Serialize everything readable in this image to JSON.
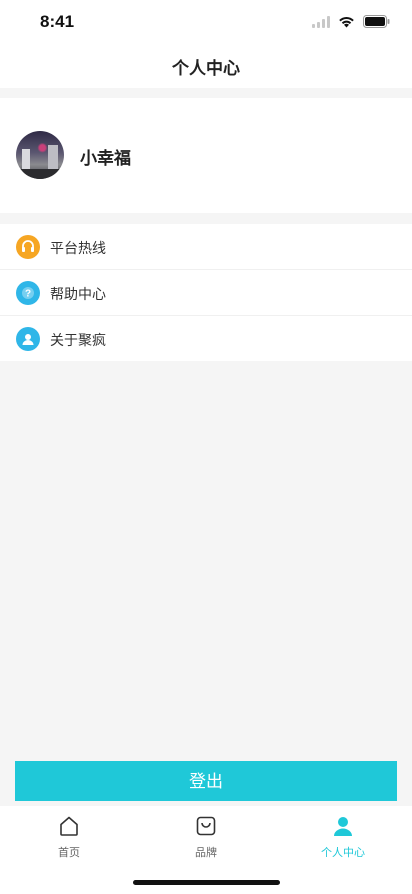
{
  "status_bar": {
    "time": "8:41"
  },
  "nav": {
    "title": "个人中心"
  },
  "profile": {
    "username": "小幸福"
  },
  "menu": {
    "items": [
      {
        "label": "平台热线",
        "icon": "headset-icon",
        "color": "#f6a623"
      },
      {
        "label": "帮助中心",
        "icon": "question-icon",
        "color": "#2fb6e8"
      },
      {
        "label": "关于聚疯",
        "icon": "user-icon",
        "color": "#2fb6e8"
      }
    ]
  },
  "logout": {
    "label": "登出",
    "color": "#1fc8d8"
  },
  "tabs": [
    {
      "label": "首页",
      "icon": "home-icon",
      "active": false
    },
    {
      "label": "品牌",
      "icon": "shopping-bag-icon",
      "active": false
    },
    {
      "label": "个人中心",
      "icon": "person-icon",
      "active": true
    }
  ],
  "accent_color": "#1fc8d8"
}
